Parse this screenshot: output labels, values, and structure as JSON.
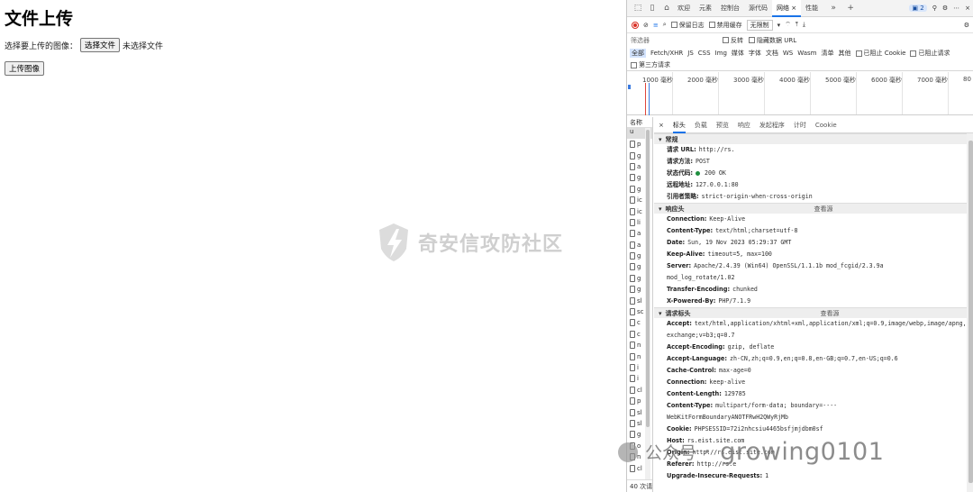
{
  "page": {
    "title": "文件上传",
    "file_label": "选择要上传的图像：",
    "choose_button": "选择文件",
    "no_file": "未选择文件",
    "upload_button": "上传图像",
    "watermark": "奇安信攻防社区"
  },
  "devtools": {
    "tabs": [
      {
        "label": "欢迎",
        "active": false
      },
      {
        "label": "元素",
        "active": false
      },
      {
        "label": "控制台",
        "active": false
      },
      {
        "label": "源代码",
        "active": false
      },
      {
        "label": "网络",
        "active": true
      },
      {
        "label": "性能",
        "active": false
      }
    ],
    "issue_count": "2",
    "toolbar": {
      "preserve_log": "保留日志",
      "disable_cache": "禁用缓存",
      "throttle": "无限制"
    },
    "filter": {
      "placeholder": "筛选器",
      "invert": "反转",
      "hide_data_urls": "隐藏数据 URL"
    },
    "types": [
      "全部",
      "Fetch/XHR",
      "JS",
      "CSS",
      "Img",
      "媒体",
      "字体",
      "文档",
      "WS",
      "Wasm",
      "清单",
      "其他"
    ],
    "blocked_cookies": "已阻止 Cookie",
    "blocked_requests": "已阻止请求",
    "third_party": "第三方请求",
    "timeline_ticks": [
      "1000 毫秒",
      "2000 毫秒",
      "3000 毫秒",
      "4000 毫秒",
      "5000 毫秒",
      "6000 毫秒",
      "7000 毫秒",
      "80"
    ],
    "request_list": {
      "header": "名称",
      "items": [
        "p",
        "g",
        "a",
        "g",
        "g",
        "ic",
        "ic",
        "li",
        "a",
        "a",
        "g",
        "g",
        "g",
        "g",
        "sl",
        "sc",
        "c",
        "c",
        "n",
        "n",
        "i",
        "i",
        "cl",
        "p",
        "sl",
        "sl",
        "g",
        "o",
        "n",
        "cl"
      ],
      "footer": "40 次请"
    },
    "detail_tabs": [
      "标头",
      "负载",
      "预览",
      "响应",
      "发起程序",
      "计时",
      "Cookie"
    ],
    "general": {
      "title": "常规",
      "rows": [
        {
          "k": "请求 URL:",
          "v": "http://rs."
        },
        {
          "k": "请求方法:",
          "v": "POST"
        },
        {
          "k": "状态代码:",
          "v": "200 OK"
        },
        {
          "k": "远程地址:",
          "v": "127.0.0.1:80"
        },
        {
          "k": "引用者策略:",
          "v": "strict-origin-when-cross-origin"
        }
      ]
    },
    "response_headers": {
      "title": "响应头",
      "raw": "查看源",
      "rows": [
        {
          "k": "Connection:",
          "v": "Keep-Alive"
        },
        {
          "k": "Content-Type:",
          "v": "text/html;charset=utf-8"
        },
        {
          "k": "Date:",
          "v": "Sun, 19 Nov 2023 05:29:37 GMT"
        },
        {
          "k": "Keep-Alive:",
          "v": "timeout=5, max=100"
        },
        {
          "k": "Server:",
          "v": "Apache/2.4.39 (Win64) OpenSSL/1.1.1b mod_fcgid/2.3.9a mod_log_rotate/1.02"
        },
        {
          "k": "Transfer-Encoding:",
          "v": "chunked"
        },
        {
          "k": "X-Powered-By:",
          "v": "PHP/7.1.9"
        }
      ]
    },
    "request_headers": {
      "title": "请求标头",
      "raw": "查看源",
      "rows": [
        {
          "k": "Accept:",
          "v": "text/html,application/xhtml+xml,application/xml;q=0.9,image/webp,image/apng,*/*;q=0.8,application/signed-exchange;v=b3;q=0.7"
        },
        {
          "k": "Accept-Encoding:",
          "v": "gzip, deflate"
        },
        {
          "k": "Accept-Language:",
          "v": "zh-CN,zh;q=0.9,en;q=0.8,en-GB;q=0.7,en-US;q=0.6"
        },
        {
          "k": "Cache-Control:",
          "v": "max-age=0"
        },
        {
          "k": "Connection:",
          "v": "keep-alive"
        },
        {
          "k": "Content-Length:",
          "v": "129785"
        },
        {
          "k": "Content-Type:",
          "v": "multipart/form-data; boundary=----WebKitFormBoundaryANOTFRwH2QWyRjMb"
        },
        {
          "k": "Cookie:",
          "v": "PHPSESSID=72i2nhcsiu4465bsfjmjdbm0sf"
        },
        {
          "k": "Host:",
          "v": "rs.eist.site.com"
        },
        {
          "k": "Origin:",
          "v": "http://rs.eist.site.com"
        },
        {
          "k": "Referer:",
          "v": "http://rs.e"
        },
        {
          "k": "Upgrade-Insecure-Requests:",
          "v": "1"
        }
      ]
    },
    "overlay_watermark": {
      "prefix": "公众号",
      "text": "· growing0101"
    }
  }
}
